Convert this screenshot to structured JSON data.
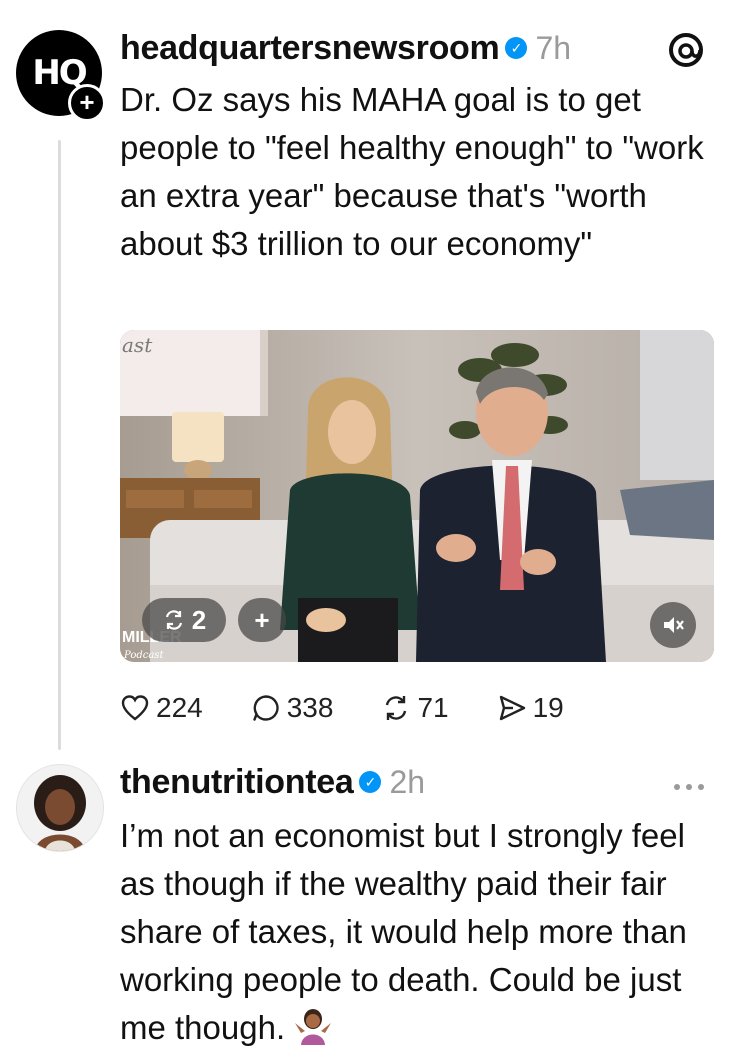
{
  "posts": [
    {
      "avatar_text": "HQ",
      "username": "headquartersnewsroom",
      "verified": true,
      "time": "7h",
      "text": "Dr. Oz says his MAHA goal is to get people to \"feel healthy enough\" to \"work an extra year\" because that's \"worth about $3 trillion to our economy\"",
      "media": {
        "corner_text": "ast",
        "logo_text": "MILLER",
        "logo_sub": "Podcast",
        "carousel_count": "2",
        "add_label": "+"
      },
      "stats": {
        "likes": "224",
        "comments": "338",
        "reposts": "71",
        "shares": "19"
      }
    },
    {
      "username": "thenutritiontea",
      "verified": true,
      "time": "2h",
      "text": "I’m not an economist but I strongly feel as though if the wealthy paid their fair share of taxes, it would help more than working people to death. Could be just me though.",
      "emoji": "person-shrugging"
    }
  ],
  "colors": {
    "verified": "#0095f6",
    "muted": "#9a9a9a",
    "thread_line": "#dcdcdc"
  },
  "icons": [
    "threads-logo-icon",
    "heart-icon",
    "comment-icon",
    "repost-icon",
    "share-icon",
    "mute-icon",
    "more-icon",
    "shrug-emoji"
  ]
}
